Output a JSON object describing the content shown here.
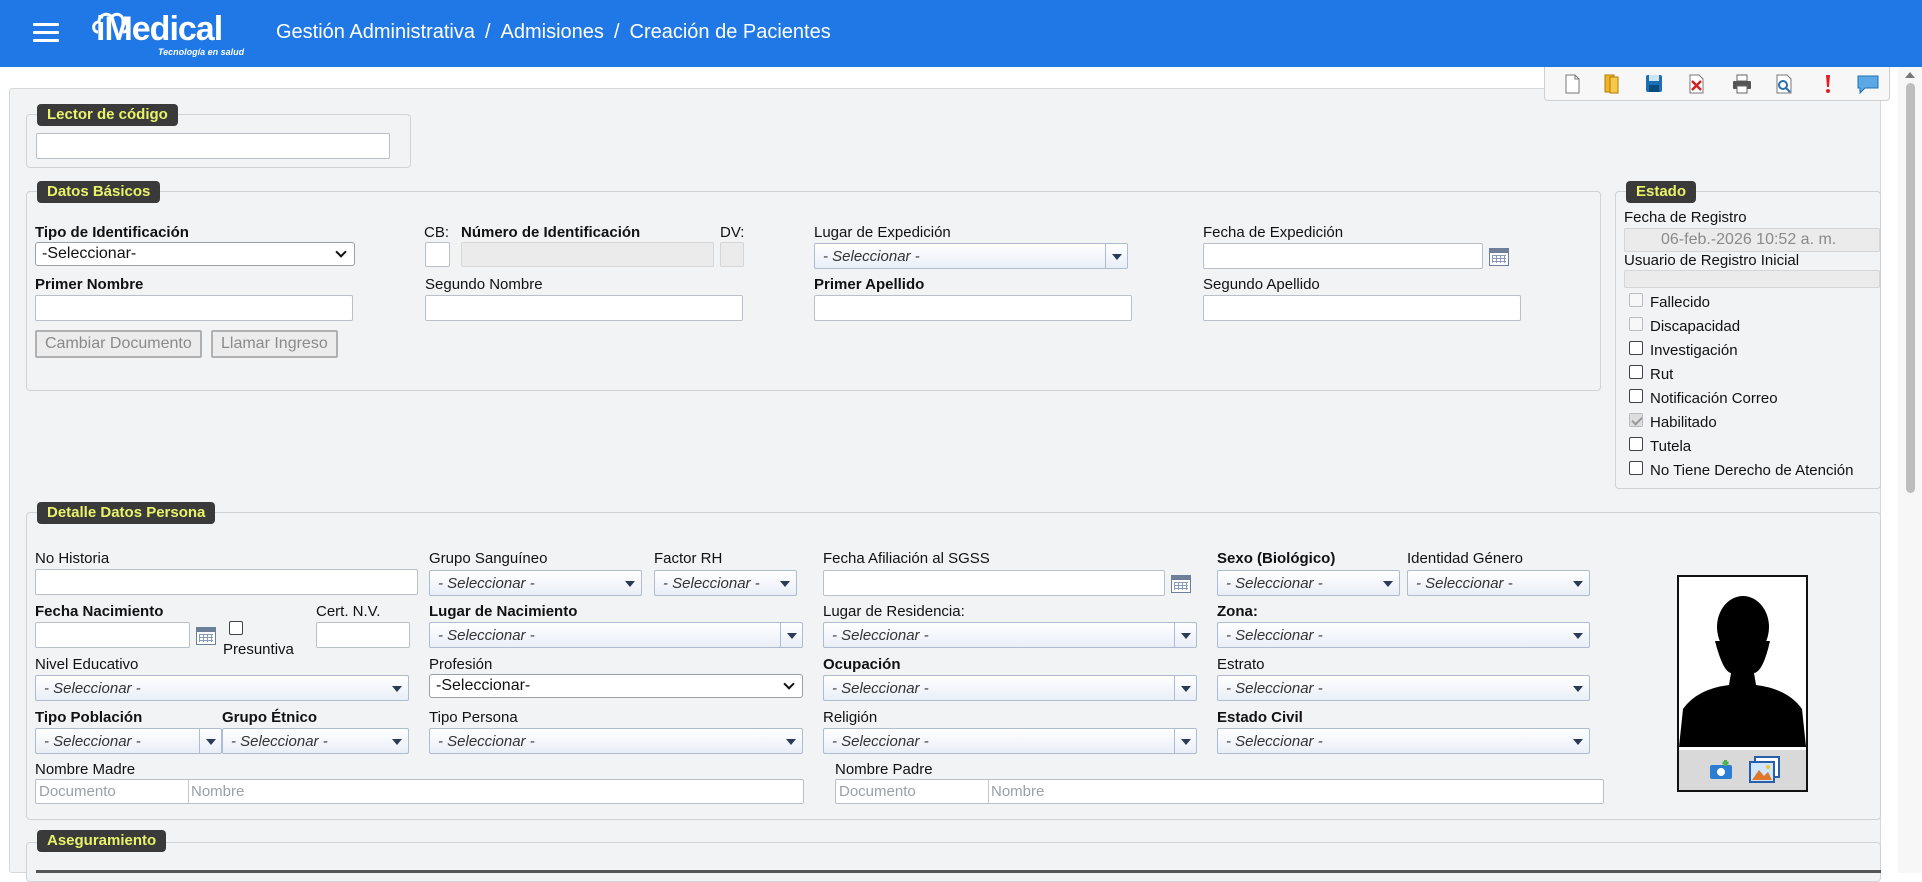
{
  "header": {
    "logo_text": "iMedical",
    "logo_tagline": "Tecnología en salud",
    "breadcrumb": [
      "Gestión Administrativa",
      "Admisiones",
      "Creación de Pacientes"
    ],
    "separator": "/"
  },
  "toolbar": {
    "buttons": [
      "new-document-icon",
      "open-folder-icon",
      "save-icon",
      "delete-icon",
      "print-icon",
      "preview-icon",
      "alert-icon",
      "comments-icon"
    ]
  },
  "lector": {
    "legend": "Lector de código",
    "value": ""
  },
  "datos_basicos": {
    "legend": "Datos Básicos",
    "tipo_id_label": "Tipo de Identificación",
    "tipo_id_value": "-Seleccionar-",
    "cb_label": "CB:",
    "numero_id_label": "Número de Identificación",
    "dv_label": "DV:",
    "lugar_exp_label": "Lugar de Expedición",
    "lugar_exp_value": "- Seleccionar -",
    "fecha_exp_label": "Fecha de Expedición",
    "primer_nombre_label": "Primer Nombre",
    "segundo_nombre_label": "Segundo Nombre",
    "primer_apellido_label": "Primer Apellido",
    "segundo_apellido_label": "Segundo Apellido",
    "cambiar_documento": "Cambiar Documento",
    "llamar_ingreso": "Llamar Ingreso"
  },
  "estado": {
    "legend": "Estado",
    "fecha_registro_label": "Fecha de Registro",
    "fecha_registro_value": "06-feb.-2026 10:52 a. m.",
    "usuario_label": "Usuario de Registro Inicial",
    "checks": [
      {
        "label": "Fallecido",
        "checked": false,
        "disabled": true
      },
      {
        "label": "Discapacidad",
        "checked": false,
        "disabled": true
      },
      {
        "label": "Investigación",
        "checked": false,
        "disabled": false
      },
      {
        "label": "Rut",
        "checked": false,
        "disabled": false
      },
      {
        "label": "Notificación Correo",
        "checked": false,
        "disabled": false
      },
      {
        "label": "Habilitado",
        "checked": true,
        "disabled": true
      },
      {
        "label": "Tutela",
        "checked": false,
        "disabled": false
      },
      {
        "label": "No Tiene Derecho de Atención",
        "checked": false,
        "disabled": false
      }
    ]
  },
  "detalle": {
    "legend": "Detalle Datos Persona",
    "no_historia": "No Historia",
    "grupo_sanguineo": "Grupo Sanguíneo",
    "factor_rh": "Factor RH",
    "fecha_afiliacion": "Fecha Afiliación al SGSS",
    "sexo": "Sexo (Biológico)",
    "identidad_genero": "Identidad Género",
    "fecha_nacimiento": "Fecha Nacimiento",
    "presuntiva": "Presuntiva",
    "cert_nv": "Cert. N.V.",
    "lugar_nacimiento": "Lugar de Nacimiento",
    "lugar_residencia": "Lugar de Residencia:",
    "zona": "Zona:",
    "nivel_educativo": "Nivel Educativo",
    "profesion": "Profesión",
    "profesion_value": "-Seleccionar-",
    "ocupacion": "Ocupación",
    "estrato": "Estrato",
    "tipo_poblacion": "Tipo Población",
    "grupo_etnico": "Grupo Étnico",
    "tipo_persona": "Tipo Persona",
    "religion": "Religión",
    "estado_civil": "Estado Civil",
    "nombre_madre": "Nombre Madre",
    "nombre_padre": "Nombre Padre",
    "documento_ph": "Documento",
    "nombre_ph": "Nombre",
    "select_ph": "- Seleccionar -"
  },
  "aseguramiento": {
    "legend": "Aseguramiento"
  },
  "colors": {
    "header": "#1f78e6",
    "legend_bg": "#3a3a3a",
    "legend_text": "#e8f36a",
    "panel": "#f2f3f5"
  }
}
